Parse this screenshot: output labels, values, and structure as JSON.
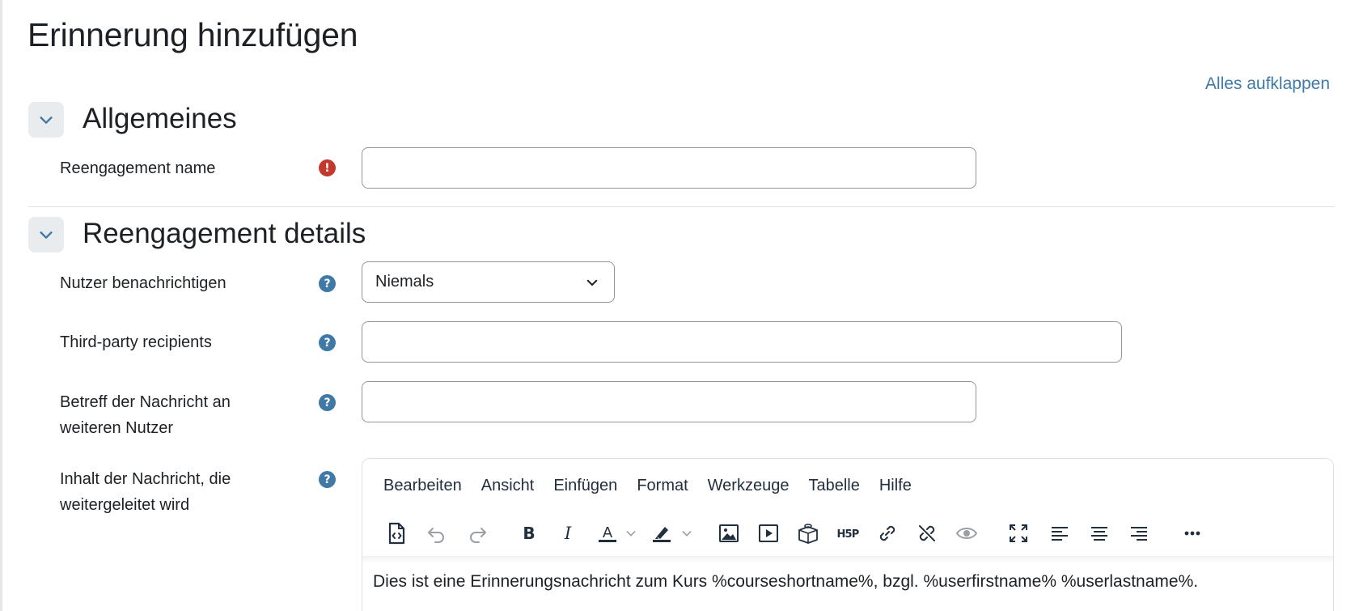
{
  "page": {
    "title": "Erinnerung hinzufügen",
    "expand_all": "Alles aufklappen"
  },
  "sections": {
    "general": {
      "title": "Allgemeines"
    },
    "details": {
      "title": "Reengagement details"
    }
  },
  "fields": {
    "name": {
      "label": "Reengagement name",
      "value": ""
    },
    "notify": {
      "label": "Nutzer benachrichtigen",
      "selected": "Niemals"
    },
    "thirdparty": {
      "label": "Third-party recipients",
      "value": ""
    },
    "subject": {
      "label_line1": "Betreff der Nachricht an",
      "label_line2": "weiteren Nutzer",
      "value": ""
    },
    "content": {
      "label_line1": "Inhalt der Nachricht, die",
      "label_line2": "weitergeleitet wird"
    }
  },
  "editor": {
    "menu": [
      "Bearbeiten",
      "Ansicht",
      "Einfügen",
      "Format",
      "Werkzeuge",
      "Tabelle",
      "Hilfe"
    ],
    "text": "Dies ist eine Erinnerungsnachricht zum Kurs %courseshortname%, bzgl. %userfirstname% %userlastname%.",
    "h5p_label": "H5P",
    "toolbar_icons": [
      "source-code-icon",
      "undo-icon",
      "redo-icon",
      "bold-icon",
      "italic-icon",
      "text-color-icon",
      "chevron-down-icon",
      "highlight-icon",
      "chevron-down-icon",
      "image-icon",
      "media-icon",
      "block-icon",
      "h5p-icon",
      "link-icon",
      "unlink-icon",
      "preview-icon",
      "fullscreen-icon",
      "align-left-icon",
      "align-center-icon",
      "align-right-icon",
      "more-icon"
    ]
  },
  "colors": {
    "accent": "#3f79a6",
    "required": "#c3392d",
    "text": "#1d2125",
    "toggle_bg": "#e9ecef"
  }
}
